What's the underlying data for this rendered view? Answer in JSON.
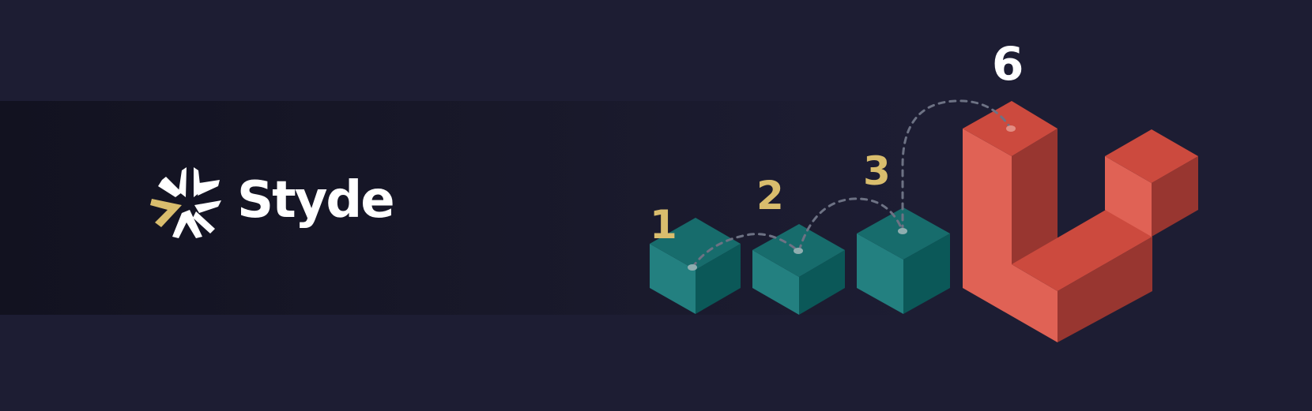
{
  "brand": {
    "name": "Styde",
    "mark_icon": "styde-star-logo"
  },
  "steps": [
    {
      "label": "1",
      "color": "#d9bd6d"
    },
    {
      "label": "2",
      "color": "#d9bd6d"
    },
    {
      "label": "3",
      "color": "#d9bd6d"
    },
    {
      "label": "6",
      "color": "#ffffff"
    }
  ],
  "colors": {
    "background": "#1d1d33",
    "band": "#14141f",
    "teal_top": "#176c6c",
    "teal_left": "#238080",
    "teal_right": "#0b5858",
    "red_top": "#cc4a3e",
    "red_left": "#e06255",
    "red_right": "#983630",
    "gold": "#d9bd6d",
    "dashes": "#6d7284"
  },
  "illustration_icon": "laravel-blocks-icon"
}
